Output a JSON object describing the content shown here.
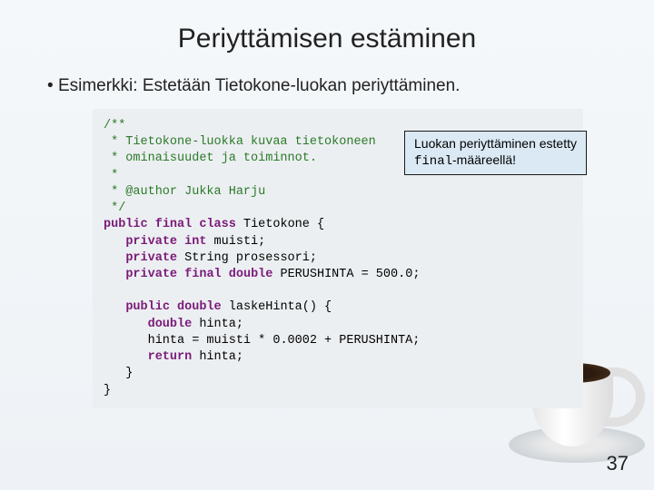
{
  "title": "Periyttämisen estäminen",
  "bullet": "Esimerkki: Estetään Tietokone-luokan periyttäminen.",
  "callout": {
    "line1": "Luokan periyttäminen estetty",
    "code": "final",
    "line2_rest": "-määreellä!"
  },
  "code": {
    "c1": "/**",
    "c2": " * Tietokone-luokka kuvaa tietokoneen",
    "c3": " * ominaisuudet ja toiminnot.",
    "c4": " *",
    "c5": " * @author Jukka Harju",
    "c6": " */",
    "kw_public": "public",
    "kw_final": "final",
    "kw_class": "class",
    "cls_name": "Tietokone",
    "brace_open": " {",
    "kw_private": "private",
    "ty_int": "int",
    "fld_muisti": " muisti;",
    "ty_String": "String",
    "fld_prosessori": " prosessori;",
    "ty_double": "double",
    "const_name": " PERUSHINTA = ",
    "const_val": "500.0",
    "semicolon": ";",
    "method_name": " laskeHinta() {",
    "local_decl": " hinta;",
    "assign": "      hinta = muisti * ",
    "factor": "0.0002",
    "plus_rest": " + PERUSHINTA;",
    "kw_return": "return",
    "ret_rest": " hinta;",
    "brace_close1": "   }",
    "brace_close2": "}"
  },
  "page_number": "37"
}
